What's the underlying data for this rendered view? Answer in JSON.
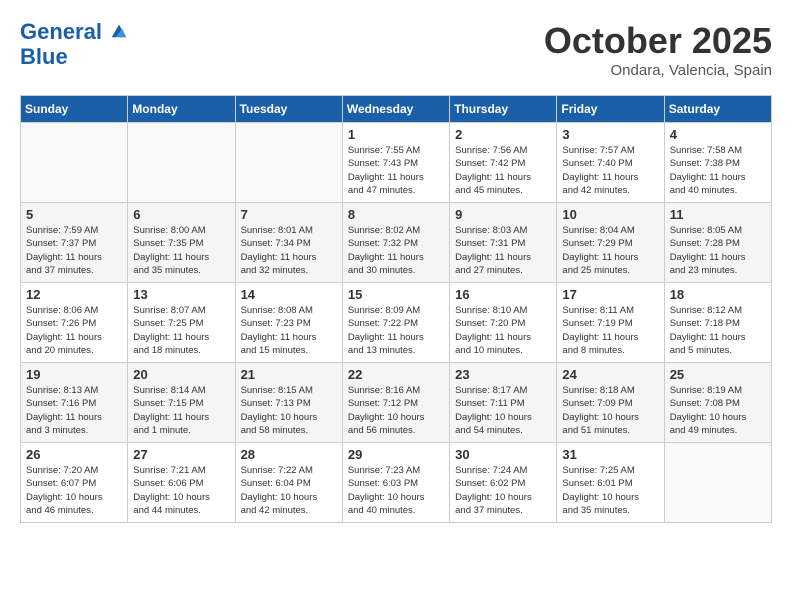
{
  "header": {
    "logo_line1": "General",
    "logo_line2": "Blue",
    "month": "October 2025",
    "location": "Ondara, Valencia, Spain"
  },
  "weekdays": [
    "Sunday",
    "Monday",
    "Tuesday",
    "Wednesday",
    "Thursday",
    "Friday",
    "Saturday"
  ],
  "weeks": [
    [
      {
        "day": "",
        "info": ""
      },
      {
        "day": "",
        "info": ""
      },
      {
        "day": "",
        "info": ""
      },
      {
        "day": "1",
        "info": "Sunrise: 7:55 AM\nSunset: 7:43 PM\nDaylight: 11 hours\nand 47 minutes."
      },
      {
        "day": "2",
        "info": "Sunrise: 7:56 AM\nSunset: 7:42 PM\nDaylight: 11 hours\nand 45 minutes."
      },
      {
        "day": "3",
        "info": "Sunrise: 7:57 AM\nSunset: 7:40 PM\nDaylight: 11 hours\nand 42 minutes."
      },
      {
        "day": "4",
        "info": "Sunrise: 7:58 AM\nSunset: 7:38 PM\nDaylight: 11 hours\nand 40 minutes."
      }
    ],
    [
      {
        "day": "5",
        "info": "Sunrise: 7:59 AM\nSunset: 7:37 PM\nDaylight: 11 hours\nand 37 minutes."
      },
      {
        "day": "6",
        "info": "Sunrise: 8:00 AM\nSunset: 7:35 PM\nDaylight: 11 hours\nand 35 minutes."
      },
      {
        "day": "7",
        "info": "Sunrise: 8:01 AM\nSunset: 7:34 PM\nDaylight: 11 hours\nand 32 minutes."
      },
      {
        "day": "8",
        "info": "Sunrise: 8:02 AM\nSunset: 7:32 PM\nDaylight: 11 hours\nand 30 minutes."
      },
      {
        "day": "9",
        "info": "Sunrise: 8:03 AM\nSunset: 7:31 PM\nDaylight: 11 hours\nand 27 minutes."
      },
      {
        "day": "10",
        "info": "Sunrise: 8:04 AM\nSunset: 7:29 PM\nDaylight: 11 hours\nand 25 minutes."
      },
      {
        "day": "11",
        "info": "Sunrise: 8:05 AM\nSunset: 7:28 PM\nDaylight: 11 hours\nand 23 minutes."
      }
    ],
    [
      {
        "day": "12",
        "info": "Sunrise: 8:06 AM\nSunset: 7:26 PM\nDaylight: 11 hours\nand 20 minutes."
      },
      {
        "day": "13",
        "info": "Sunrise: 8:07 AM\nSunset: 7:25 PM\nDaylight: 11 hours\nand 18 minutes."
      },
      {
        "day": "14",
        "info": "Sunrise: 8:08 AM\nSunset: 7:23 PM\nDaylight: 11 hours\nand 15 minutes."
      },
      {
        "day": "15",
        "info": "Sunrise: 8:09 AM\nSunset: 7:22 PM\nDaylight: 11 hours\nand 13 minutes."
      },
      {
        "day": "16",
        "info": "Sunrise: 8:10 AM\nSunset: 7:20 PM\nDaylight: 11 hours\nand 10 minutes."
      },
      {
        "day": "17",
        "info": "Sunrise: 8:11 AM\nSunset: 7:19 PM\nDaylight: 11 hours\nand 8 minutes."
      },
      {
        "day": "18",
        "info": "Sunrise: 8:12 AM\nSunset: 7:18 PM\nDaylight: 11 hours\nand 5 minutes."
      }
    ],
    [
      {
        "day": "19",
        "info": "Sunrise: 8:13 AM\nSunset: 7:16 PM\nDaylight: 11 hours\nand 3 minutes."
      },
      {
        "day": "20",
        "info": "Sunrise: 8:14 AM\nSunset: 7:15 PM\nDaylight: 11 hours\nand 1 minute."
      },
      {
        "day": "21",
        "info": "Sunrise: 8:15 AM\nSunset: 7:13 PM\nDaylight: 10 hours\nand 58 minutes."
      },
      {
        "day": "22",
        "info": "Sunrise: 8:16 AM\nSunset: 7:12 PM\nDaylight: 10 hours\nand 56 minutes."
      },
      {
        "day": "23",
        "info": "Sunrise: 8:17 AM\nSunset: 7:11 PM\nDaylight: 10 hours\nand 54 minutes."
      },
      {
        "day": "24",
        "info": "Sunrise: 8:18 AM\nSunset: 7:09 PM\nDaylight: 10 hours\nand 51 minutes."
      },
      {
        "day": "25",
        "info": "Sunrise: 8:19 AM\nSunset: 7:08 PM\nDaylight: 10 hours\nand 49 minutes."
      }
    ],
    [
      {
        "day": "26",
        "info": "Sunrise: 7:20 AM\nSunset: 6:07 PM\nDaylight: 10 hours\nand 46 minutes."
      },
      {
        "day": "27",
        "info": "Sunrise: 7:21 AM\nSunset: 6:06 PM\nDaylight: 10 hours\nand 44 minutes."
      },
      {
        "day": "28",
        "info": "Sunrise: 7:22 AM\nSunset: 6:04 PM\nDaylight: 10 hours\nand 42 minutes."
      },
      {
        "day": "29",
        "info": "Sunrise: 7:23 AM\nSunset: 6:03 PM\nDaylight: 10 hours\nand 40 minutes."
      },
      {
        "day": "30",
        "info": "Sunrise: 7:24 AM\nSunset: 6:02 PM\nDaylight: 10 hours\nand 37 minutes."
      },
      {
        "day": "31",
        "info": "Sunrise: 7:25 AM\nSunset: 6:01 PM\nDaylight: 10 hours\nand 35 minutes."
      },
      {
        "day": "",
        "info": ""
      }
    ]
  ]
}
